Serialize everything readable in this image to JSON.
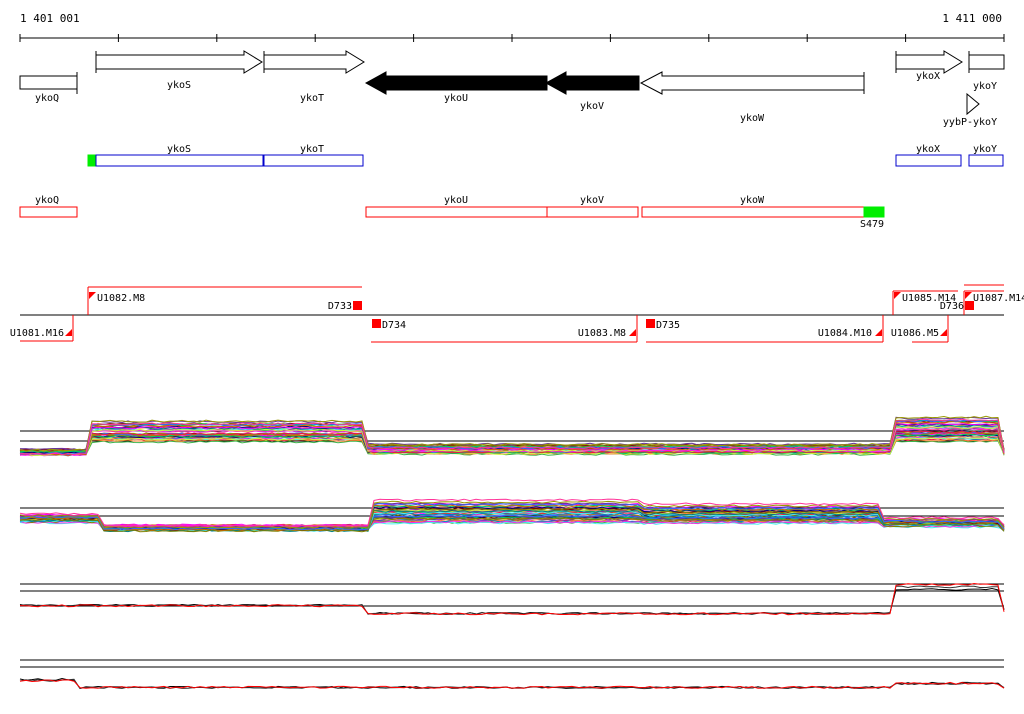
{
  "coordinates": {
    "start": "1 401 001",
    "end": "1 411 000"
  },
  "genes": [
    {
      "name": "ykoQ",
      "strand": "+",
      "style": "box"
    },
    {
      "name": "ykoS",
      "strand": "+"
    },
    {
      "name": "ykoT",
      "strand": "+"
    },
    {
      "name": "ykoU",
      "strand": "-",
      "filled": true
    },
    {
      "name": "ykoV",
      "strand": "-",
      "filled": true
    },
    {
      "name": "ykoW",
      "strand": "-"
    },
    {
      "name": "ykoX",
      "strand": "+"
    },
    {
      "name": "ykoY",
      "strand": "+"
    },
    {
      "name": "yybP-ykoY",
      "strand": "+",
      "type": "small-triangle"
    }
  ],
  "transcripts_blue": [
    "ykoS",
    "ykoT",
    "ykoX",
    "ykoY"
  ],
  "transcripts_red": [
    "ykoQ",
    "ykoU",
    "ykoV",
    "ykoW"
  ],
  "site_label": "S479",
  "segments_upper": [
    "U1082.M8",
    "D733",
    "U1085.M14",
    "D736",
    "U1087.M14"
  ],
  "segments_lower": [
    "U1081.M16",
    "D734",
    "U1083.M8",
    "D735",
    "U1084.M10",
    "U1086.M5"
  ],
  "colors": {
    "track_red": "#ff0000",
    "transcript_blue": "#0000cc",
    "site_green": "#00ee00",
    "gene_fill": "#000000"
  }
}
